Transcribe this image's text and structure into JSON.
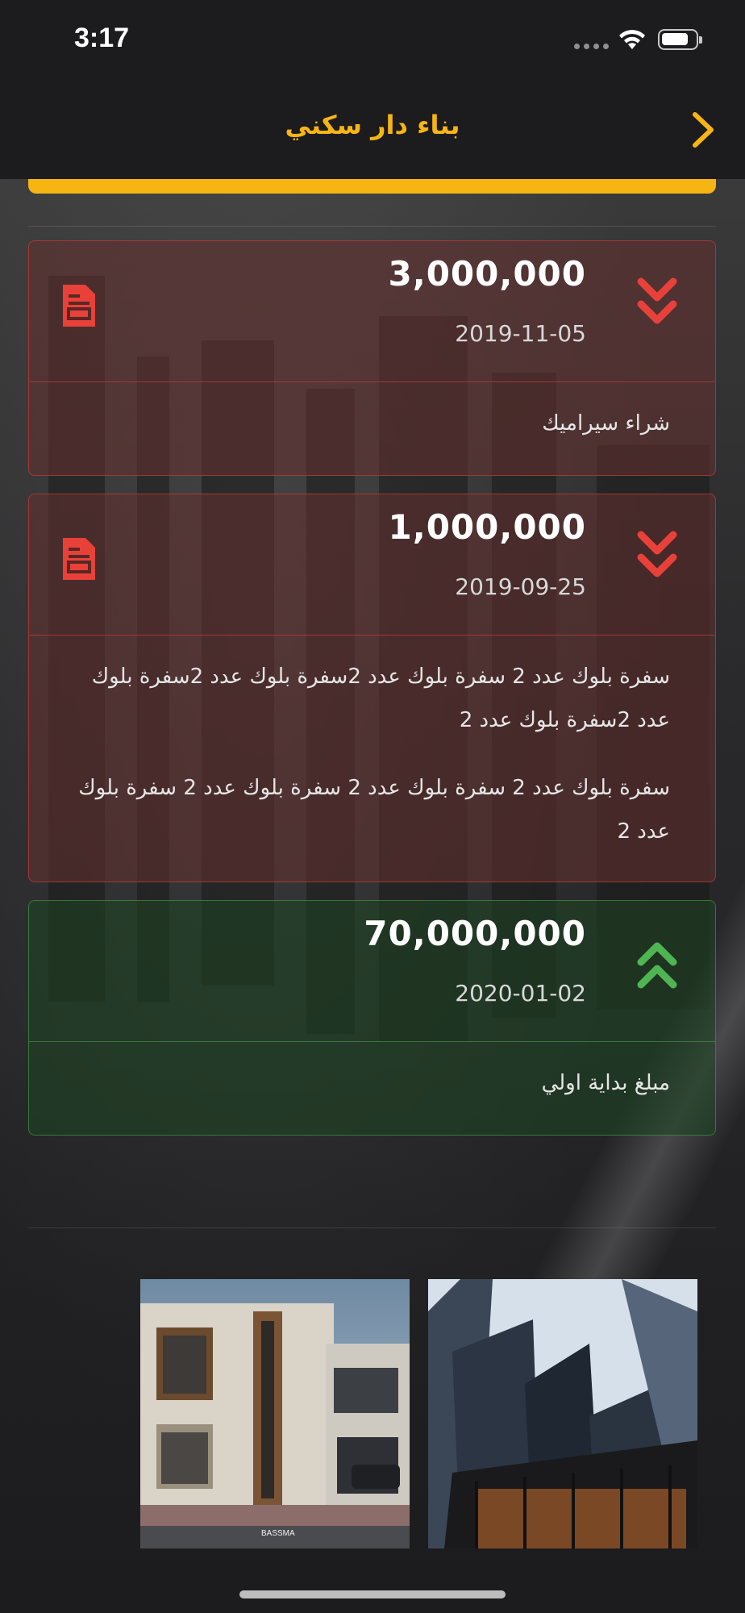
{
  "status_bar": {
    "time": "3:17"
  },
  "nav": {
    "title": "بناء دار سكني",
    "back_icon": "chevron-right-icon"
  },
  "colors": {
    "accent": "#f7b514",
    "expense": "#e8413a",
    "income": "#4fb552"
  },
  "transactions": [
    {
      "type": "expense",
      "amount": "3,000,000",
      "date": "2019-11-05",
      "description": [
        "شراء سيراميك"
      ],
      "arrow_icon": "double-chevron-down-icon",
      "doc_icon": "document-icon"
    },
    {
      "type": "expense",
      "amount": "1,000,000",
      "date": "2019-09-25",
      "description": [
        "سفرة بلوك عدد 2 سفرة بلوك عدد 2سفرة بلوك عدد 2سفرة بلوك عدد 2سفرة بلوك عدد 2",
        "سفرة بلوك عدد 2 سفرة بلوك عدد 2 سفرة بلوك عدد 2 سفرة بلوك عدد 2"
      ],
      "arrow_icon": "double-chevron-down-icon",
      "doc_icon": "document-icon"
    },
    {
      "type": "income",
      "amount": "70,000,000",
      "date": "2020-01-02",
      "description": [
        "مبلغ بداية اولي"
      ],
      "arrow_icon": "double-chevron-up-icon"
    }
  ],
  "gallery": {
    "images": [
      "house-photo",
      "towers-photo"
    ],
    "house_caption": "BASSMA"
  }
}
